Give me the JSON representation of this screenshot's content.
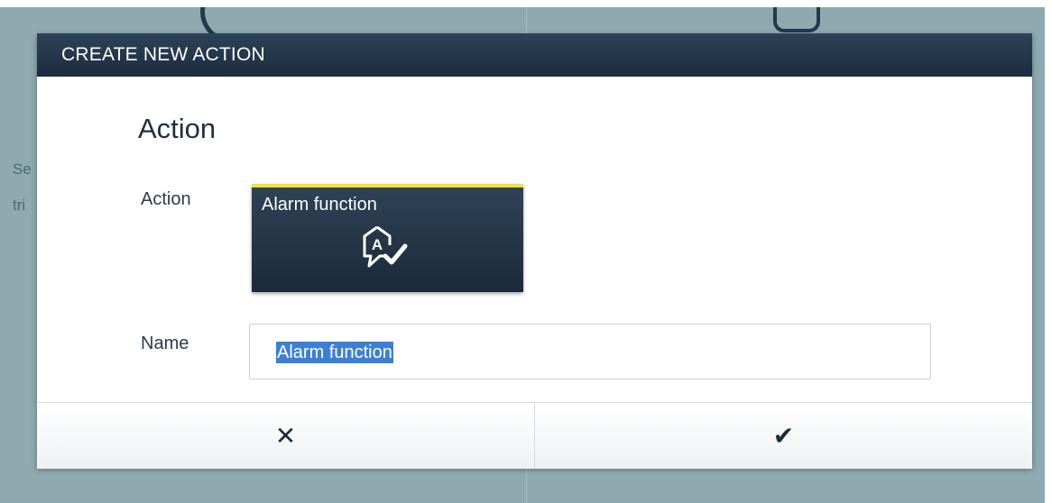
{
  "background": {
    "partial_text_line1": "Se",
    "partial_text_line2": "tri"
  },
  "dialog": {
    "title": "CREATE NEW ACTION",
    "section_title": "Action",
    "action_label": "Action",
    "action_tile": {
      "label": "Alarm function",
      "icon": "alarm-function-icon",
      "accent_color": "#f2e33a"
    },
    "name_label": "Name",
    "name_value": "Alarm function",
    "cancel_icon": "✕",
    "confirm_icon": "✔"
  }
}
